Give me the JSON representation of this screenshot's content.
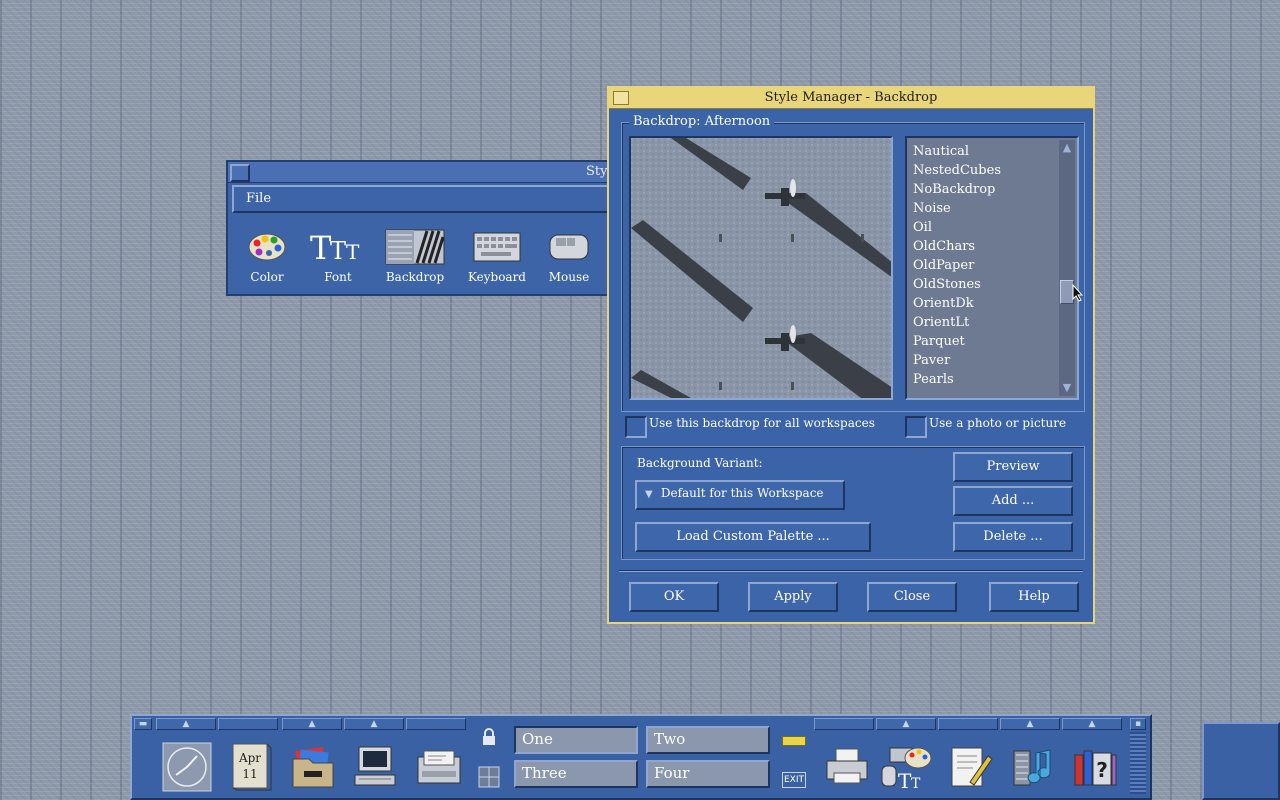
{
  "style_manager": {
    "title": "Styl",
    "menu": {
      "file": "File"
    },
    "icons": [
      {
        "name": "color-icon",
        "label": "Color"
      },
      {
        "name": "font-icon",
        "label": "Font"
      },
      {
        "name": "backdrop-icon",
        "label": "Backdrop"
      },
      {
        "name": "keyboard-icon",
        "label": "Keyboard"
      },
      {
        "name": "mouse-icon",
        "label": "Mouse"
      }
    ]
  },
  "dialog": {
    "title": "Style Manager - Backdrop",
    "group_label": "Backdrop: Afternoon",
    "backdrop_list": [
      "Nautical",
      "NestedCubes",
      "NoBackdrop",
      "Noise",
      "Oil",
      "OldChars",
      "OldPaper",
      "OldStones",
      "OrientDk",
      "OrientLt",
      "Parquet",
      "Paver",
      "Pearls"
    ],
    "checkboxes": {
      "all_workspaces": "Use this backdrop for all workspaces",
      "photo": "Use a photo or picture"
    },
    "variant_label": "Background Variant:",
    "variant_value": "Default for this Workspace",
    "load_palette": "Load Custom Palette ...",
    "side_buttons": {
      "preview": "Preview",
      "add": "Add ...",
      "delete": "Delete ..."
    },
    "bottom_buttons": {
      "ok": "OK",
      "apply": "Apply",
      "close": "Close",
      "help": "Help"
    }
  },
  "front_panel": {
    "date": {
      "month": "Apr",
      "day": "11"
    },
    "workspaces": [
      "One",
      "Two",
      "Three",
      "Four"
    ],
    "exit_label": "EXIT"
  },
  "colors": {
    "panel_blue": "#3a61a4",
    "title_active": "#e9d57a",
    "desktop": "#8e99aa"
  }
}
